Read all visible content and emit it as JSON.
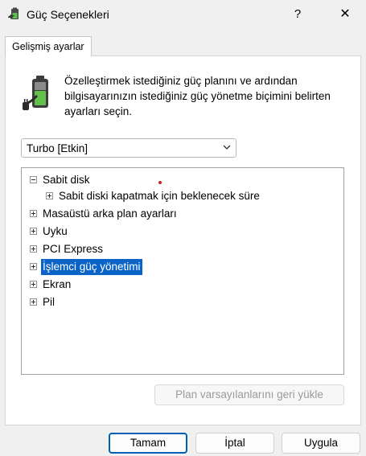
{
  "window": {
    "title": "Güç Seçenekleri",
    "help_label": "?",
    "close_label": "✕"
  },
  "tab": {
    "label": "Gelişmiş ayarlar"
  },
  "description": "Özelleştirmek istediğiniz güç planını ve ardından bilgisayarınızın istediğiniz güç yönetme biçimini belirten ayarları seçin.",
  "plan_select": {
    "value": "Turbo [Etkin]"
  },
  "tree": {
    "items": [
      {
        "label": "Sabit disk",
        "state": "expanded"
      },
      {
        "label": "Sabit diski kapatmak için beklenecek süre",
        "state": "collapsed"
      },
      {
        "label": "Masaüstü arka plan ayarları",
        "state": "collapsed"
      },
      {
        "label": "Uyku",
        "state": "collapsed"
      },
      {
        "label": "PCI Express",
        "state": "collapsed"
      },
      {
        "label": "İşlemci güç yönetimi",
        "state": "collapsed",
        "selected": true
      },
      {
        "label": "Ekran",
        "state": "collapsed"
      },
      {
        "label": "Pil",
        "state": "collapsed"
      }
    ]
  },
  "buttons": {
    "restore": "Plan varsayılanlarını geri yükle",
    "ok": "Tamam",
    "cancel": "İptal",
    "apply": "Uygula"
  },
  "colors": {
    "selection": "#0a64c8",
    "default_button_border": "#005fb8"
  },
  "icons": [
    "power-options-icon",
    "battery-plug-icon",
    "chevron-down-icon",
    "expand-icon",
    "collapse-icon"
  ]
}
